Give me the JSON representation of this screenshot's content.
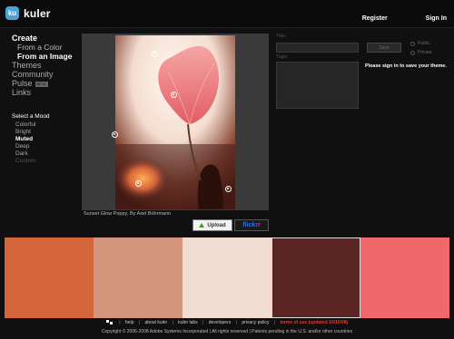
{
  "header": {
    "logo_badge": "ku",
    "app_name": "kuler",
    "register": "Register",
    "sign_in": "Sign In"
  },
  "nav": {
    "create": "Create",
    "from_color": "From a Color",
    "from_image": "From an Image",
    "themes": "Themes",
    "community": "Community",
    "pulse": "Pulse",
    "pulse_badge": "BETA",
    "links": "Links"
  },
  "mood": {
    "title": "Select a Mood",
    "items": [
      "Colorful",
      "Bright",
      "Muted",
      "Deep",
      "Dark",
      "Custom"
    ],
    "selected": "Muted"
  },
  "image": {
    "caption": "Sunset Glow Poppy, By Axel Bührmann",
    "upload_label": "Upload",
    "flickr_part1": "flickr",
    "flickr_part2": "r"
  },
  "form": {
    "title_label": "Title:",
    "save_label": "Save",
    "tags_label": "Tags:",
    "public_label": "Public",
    "private_label": "Private",
    "signin_message": "Please sign in to save your theme."
  },
  "swatches": {
    "colors": [
      "#d5653a",
      "#d4957e",
      "#f1dcd3",
      "#5a2523",
      "#f0686c"
    ],
    "selected_index": 3
  },
  "footer": {
    "links": [
      "help",
      "about kuler",
      "kuler labs",
      "developers",
      "privacy policy"
    ],
    "terms": "terms of use (updated 10/15/08)",
    "copyright": "Copyright © 2006-2008 Adobe Systems Incorporated | All rights reserved | Patents pending in the U.S. and/or other countries"
  }
}
